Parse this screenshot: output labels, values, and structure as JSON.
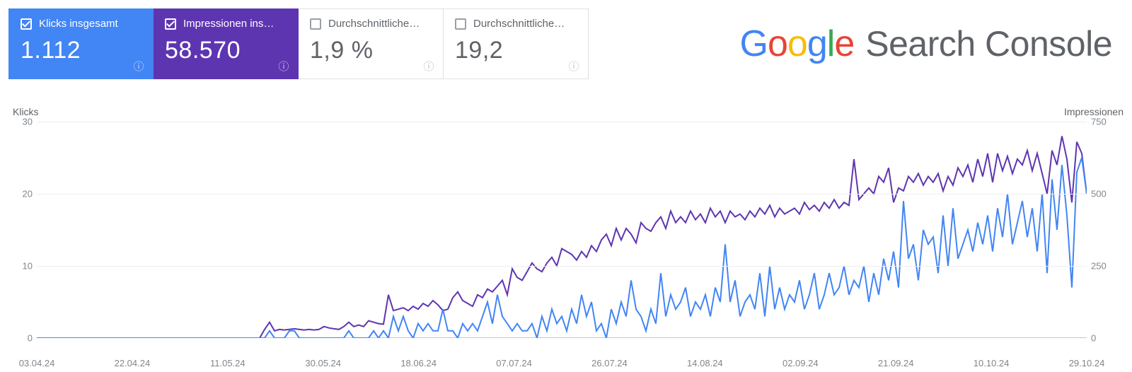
{
  "metrics": [
    {
      "label": "Klicks insgesamt",
      "value": "1.112",
      "checked": true,
      "theme": "blue"
    },
    {
      "label": "Impressionen ins…",
      "value": "58.570",
      "checked": true,
      "theme": "purple"
    },
    {
      "label": "Durchschnittliche…",
      "value": "1,9 %",
      "checked": false,
      "theme": "plain"
    },
    {
      "label": "Durchschnittliche…",
      "value": "19,2",
      "checked": false,
      "theme": "plain"
    }
  ],
  "logo": {
    "google": [
      "G",
      "o",
      "o",
      "g",
      "l",
      "e"
    ],
    "suffix": "Search Console",
    "colors": [
      "#4285F4",
      "#EA4335",
      "#FBBC05",
      "#4285F4",
      "#34A853",
      "#EA4335"
    ]
  },
  "chart_data": {
    "type": "line",
    "x_dates": [
      "03.04.24",
      "22.04.24",
      "11.05.24",
      "30.05.24",
      "18.06.24",
      "07.07.24",
      "26.07.24",
      "14.08.24",
      "02.09.24",
      "21.09.24",
      "10.10.24",
      "29.10.24"
    ],
    "left_axis": {
      "title": "Klicks",
      "ticks": [
        0,
        10,
        20,
        30
      ]
    },
    "right_axis": {
      "title": "Impressionen",
      "ticks": [
        0,
        250,
        500,
        750
      ]
    },
    "series": [
      {
        "name": "Klicks",
        "axis": "left",
        "color": "#4285F4",
        "values": [
          0,
          0,
          0,
          0,
          0,
          0,
          0,
          0,
          0,
          0,
          0,
          0,
          0,
          0,
          0,
          0,
          0,
          0,
          0,
          0,
          0,
          0,
          0,
          0,
          0,
          0,
          0,
          0,
          0,
          0,
          0,
          0,
          0,
          0,
          0,
          0,
          0,
          0,
          0,
          0,
          0,
          0,
          0,
          0,
          0,
          0,
          0,
          1,
          0,
          0,
          0,
          1,
          1,
          0,
          0,
          0,
          0,
          0,
          0,
          0,
          0,
          0,
          0,
          1,
          0,
          0,
          0,
          0,
          1,
          0,
          1,
          0,
          3,
          1,
          3,
          1,
          0,
          2,
          1,
          2,
          1,
          1,
          4,
          1,
          1,
          0,
          2,
          1,
          2,
          1,
          3,
          5,
          2,
          6,
          3,
          2,
          1,
          2,
          1,
          1,
          2,
          0,
          3,
          1,
          4,
          2,
          3,
          1,
          4,
          2,
          6,
          3,
          5,
          1,
          2,
          0,
          4,
          2,
          5,
          3,
          8,
          4,
          3,
          1,
          4,
          2,
          9,
          3,
          6,
          4,
          5,
          7,
          3,
          5,
          4,
          6,
          3,
          7,
          5,
          13,
          5,
          8,
          3,
          5,
          6,
          4,
          9,
          3,
          10,
          4,
          7,
          4,
          6,
          5,
          8,
          4,
          6,
          9,
          4,
          6,
          9,
          6,
          7,
          10,
          6,
          8,
          7,
          10,
          5,
          9,
          6,
          11,
          8,
          12,
          7,
          19,
          11,
          13,
          8,
          15,
          13,
          14,
          9,
          17,
          10,
          18,
          11,
          13,
          15,
          12,
          16,
          13,
          17,
          12,
          18,
          14,
          20,
          13,
          16,
          19,
          14,
          18,
          12,
          20,
          9,
          22,
          15,
          24,
          17,
          7,
          23,
          25,
          20
        ]
      },
      {
        "name": "Impressionen",
        "axis": "right",
        "color": "#5E35B1",
        "values": [
          0,
          0,
          0,
          0,
          0,
          0,
          0,
          0,
          0,
          0,
          0,
          0,
          0,
          0,
          0,
          0,
          0,
          0,
          0,
          0,
          0,
          0,
          0,
          0,
          0,
          0,
          0,
          0,
          0,
          0,
          0,
          0,
          0,
          0,
          0,
          0,
          0,
          0,
          0,
          0,
          0,
          0,
          0,
          0,
          0,
          0,
          30,
          55,
          25,
          30,
          28,
          30,
          32,
          30,
          28,
          30,
          28,
          30,
          40,
          35,
          32,
          30,
          40,
          55,
          40,
          45,
          40,
          60,
          55,
          50,
          48,
          150,
          95,
          100,
          105,
          95,
          110,
          100,
          120,
          110,
          130,
          115,
          95,
          100,
          140,
          160,
          130,
          120,
          110,
          150,
          140,
          170,
          160,
          180,
          200,
          150,
          240,
          210,
          200,
          230,
          260,
          240,
          230,
          260,
          280,
          250,
          310,
          300,
          290,
          270,
          300,
          280,
          320,
          300,
          340,
          360,
          320,
          380,
          340,
          380,
          360,
          330,
          400,
          380,
          370,
          400,
          420,
          380,
          440,
          400,
          420,
          400,
          440,
          410,
          430,
          400,
          450,
          420,
          440,
          400,
          440,
          420,
          430,
          410,
          440,
          420,
          450,
          430,
          460,
          420,
          450,
          430,
          440,
          450,
          430,
          470,
          445,
          460,
          440,
          470,
          450,
          480,
          450,
          470,
          460,
          620,
          480,
          500,
          520,
          500,
          560,
          540,
          590,
          470,
          520,
          510,
          560,
          540,
          570,
          530,
          560,
          540,
          570,
          510,
          560,
          530,
          590,
          560,
          600,
          540,
          620,
          560,
          640,
          540,
          640,
          580,
          630,
          570,
          620,
          600,
          650,
          580,
          640,
          570,
          500,
          650,
          600,
          700,
          620,
          470,
          680,
          640,
          500
        ]
      }
    ]
  }
}
